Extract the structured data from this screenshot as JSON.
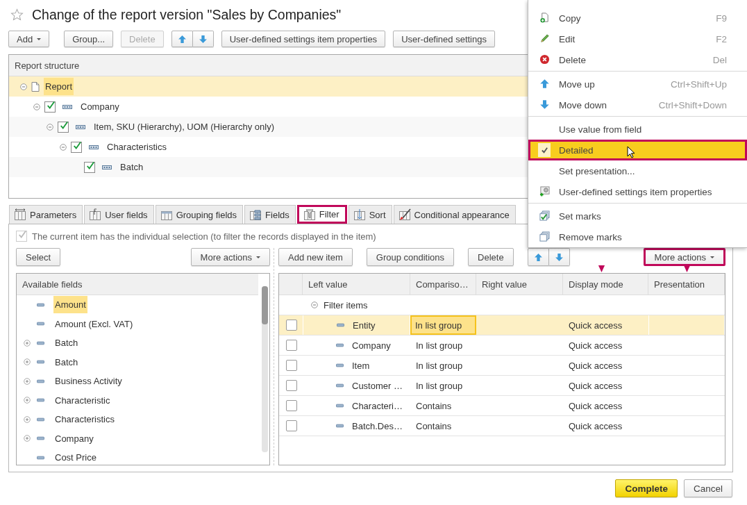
{
  "title": "Change of the report version \"Sales by Companies\"",
  "toolbar": [
    {
      "kind": "dropdown",
      "label": "Add",
      "disabled": false
    },
    {
      "kind": "button",
      "label": "Group...",
      "disabled": false
    },
    {
      "kind": "button",
      "label": "Delete",
      "disabled": true
    },
    {
      "kind": "arrows"
    },
    {
      "kind": "button",
      "label": "User-defined settings item properties",
      "disabled": false
    },
    {
      "kind": "button",
      "label": "User-defined settings",
      "disabled": false
    }
  ],
  "structure": {
    "header": "Report structure",
    "items": [
      {
        "kind": "report",
        "label": "Report",
        "selected": true,
        "expanded": true,
        "children": [
          {
            "kind": "grouping",
            "label": "Company",
            "checked": true,
            "selected": false,
            "expanded": true,
            "children": [
              {
                "kind": "grouping",
                "label": "Item, SKU (Hierarchy), UOM (Hierarchy only)",
                "checked": true,
                "selected": false,
                "expanded": true,
                "children": [
                  {
                    "kind": "grouping",
                    "label": "Characteristics",
                    "checked": true,
                    "selected": false,
                    "expanded": true,
                    "children": [
                      {
                        "kind": "grouping",
                        "label": "Batch",
                        "checked": true,
                        "selected": false
                      }
                    ]
                  }
                ]
              }
            ]
          }
        ]
      }
    ]
  },
  "tabs": [
    {
      "kind": "parameters",
      "label": "Parameters",
      "selected": false,
      "callout": false
    },
    {
      "kind": "formula",
      "label": "User fields",
      "selected": false,
      "callout": false
    },
    {
      "kind": "grouping",
      "label": "Grouping fields",
      "selected": false,
      "callout": false
    },
    {
      "kind": "fields",
      "label": "Fields",
      "selected": false,
      "callout": false
    },
    {
      "kind": "filter",
      "label": "Filter",
      "selected": true,
      "callout": true
    },
    {
      "kind": "sort",
      "label": "Sort",
      "selected": false,
      "callout": false
    },
    {
      "kind": "appearance",
      "label": "Conditional appearance",
      "selected": false,
      "callout": false
    }
  ],
  "filter_panel": {
    "individual_selection": {
      "label": "The current item has the individual selection (to filter the records displayed in the item)",
      "checked": true,
      "disabled": true
    },
    "left_toolbar": [
      {
        "kind": "button",
        "label": "Select",
        "callout": false
      },
      {
        "kind": "dropdown",
        "label": "More actions",
        "callout": false
      }
    ],
    "available_fields": {
      "header": "Available fields",
      "items": [
        {
          "label": "Amount",
          "expandable": false,
          "selected": true
        },
        {
          "label": "Amount (Excl. VAT)",
          "expandable": false,
          "selected": false
        },
        {
          "label": "Batch",
          "expandable": true,
          "selected": false
        },
        {
          "label": "Batch",
          "expandable": true,
          "selected": false
        },
        {
          "label": "Business Activity",
          "expandable": true,
          "selected": false
        },
        {
          "label": "Characteristic",
          "expandable": true,
          "selected": false
        },
        {
          "label": "Characteristics",
          "expandable": true,
          "selected": false
        },
        {
          "label": "Company",
          "expandable": true,
          "selected": false
        },
        {
          "label": "Cost Price",
          "expandable": false,
          "selected": false
        }
      ]
    },
    "right_toolbar": [
      {
        "kind": "button",
        "label": "Add new item",
        "callout": false
      },
      {
        "kind": "button",
        "label": "Group conditions",
        "callout": false
      },
      {
        "kind": "button",
        "label": "Delete",
        "callout": false
      },
      {
        "kind": "arrows"
      },
      {
        "kind": "dropdown",
        "label": "More actions",
        "callout": true
      }
    ],
    "filter_table": {
      "columns": [
        {
          "label": "Left value",
          "pointer": false
        },
        {
          "label": "Compariso…",
          "pointer": false
        },
        {
          "label": "Right value",
          "pointer": false
        },
        {
          "label": "Display mode",
          "pointer": true
        },
        {
          "label": "Presentation",
          "pointer": true
        }
      ],
      "rows": [
        {
          "kind": "group",
          "label": "Filter items",
          "expanded": true,
          "selected": false,
          "children": [
            {
              "kind": "item",
              "use": false,
              "left": "Entity",
              "comparison": "In list group",
              "display": "Quick access",
              "selected": true,
              "comparison_focused": true
            },
            {
              "kind": "item",
              "use": false,
              "left": "Company",
              "comparison": "In list group",
              "display": "Quick access",
              "selected": false,
              "comparison_focused": false
            },
            {
              "kind": "item",
              "use": false,
              "left": "Item",
              "comparison": "In list group",
              "display": "Quick access",
              "selected": false,
              "comparison_focused": false
            },
            {
              "kind": "item",
              "use": false,
              "left": "Customer …",
              "comparison": "In list group",
              "display": "Quick access",
              "selected": false,
              "comparison_focused": false
            },
            {
              "kind": "item",
              "use": false,
              "left": "Characteri…",
              "comparison": "Contains",
              "display": "Quick access",
              "selected": false,
              "comparison_focused": false
            },
            {
              "kind": "item",
              "use": false,
              "left": "Batch.Des…",
              "comparison": "Contains",
              "display": "Quick access",
              "selected": false,
              "comparison_focused": false
            }
          ]
        }
      ]
    }
  },
  "footer": [
    {
      "kind": "default",
      "label": "Complete"
    },
    {
      "kind": "plain",
      "label": "Cancel"
    }
  ],
  "context_menu": {
    "items": [
      {
        "kind": "copy",
        "label": "Copy",
        "shortcut": "F9",
        "checked": false,
        "selected": false,
        "callout": false
      },
      {
        "kind": "edit",
        "label": "Edit",
        "shortcut": "F2",
        "checked": false,
        "selected": false,
        "callout": false
      },
      {
        "kind": "delete",
        "label": "Delete",
        "shortcut": "Del",
        "checked": false,
        "selected": false,
        "callout": false
      },
      {
        "kind": "separator"
      },
      {
        "kind": "up",
        "label": "Move up",
        "shortcut": "Ctrl+Shift+Up",
        "checked": false,
        "selected": false,
        "callout": false
      },
      {
        "kind": "down",
        "label": "Move down",
        "shortcut": "Ctrl+Shift+Down",
        "checked": false,
        "selected": false,
        "callout": false
      },
      {
        "kind": "separator"
      },
      {
        "kind": "plain",
        "label": "Use value from field",
        "checked": false,
        "selected": false,
        "callout": false
      },
      {
        "kind": "plain",
        "label": "Detailed",
        "checked": true,
        "selected": true,
        "callout": true
      },
      {
        "kind": "plain",
        "label": "Set presentation...",
        "checked": false,
        "selected": false,
        "callout": false
      },
      {
        "kind": "properties",
        "label": "User-defined settings item properties",
        "checked": false,
        "selected": false,
        "callout": false
      },
      {
        "kind": "separator"
      },
      {
        "kind": "marks",
        "label": "Set marks",
        "checked": false,
        "selected": false,
        "callout": false
      },
      {
        "kind": "unmarks",
        "label": "Remove marks",
        "checked": false,
        "selected": false,
        "callout": false
      }
    ]
  }
}
